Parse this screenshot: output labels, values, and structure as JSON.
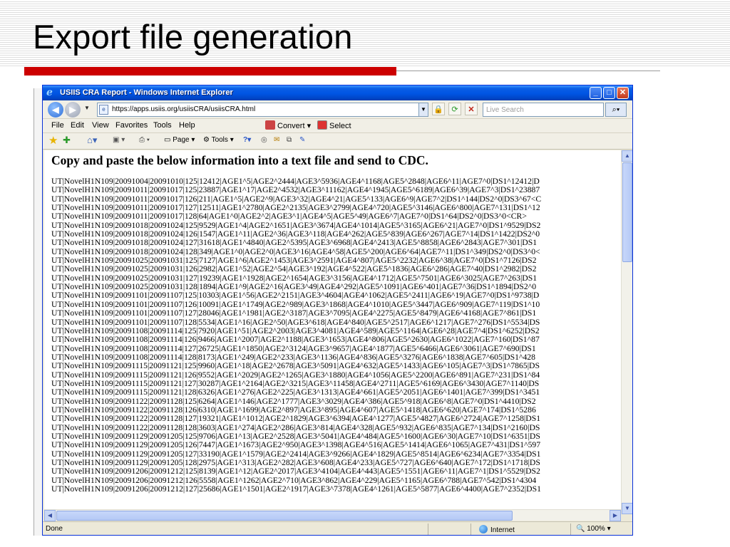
{
  "slide": {
    "title": "Export file generation"
  },
  "window": {
    "title": "USIIS CRA Report - Windows Internet Explorer",
    "controls": {
      "minimize": "_",
      "maximize": "□",
      "close": "✕"
    }
  },
  "address_bar": {
    "url": "https://apps.usiis.org/usiisCRA/usiisCRA.html",
    "search_placeholder": "Live Search"
  },
  "menu": {
    "items": [
      "File",
      "Edit",
      "View",
      "Favorites",
      "Tools",
      "Help"
    ],
    "convert": "Convert",
    "select": "Select"
  },
  "command_bar": {
    "page": "Page",
    "tools": "Tools"
  },
  "content": {
    "heading": "Copy and paste the below information into a text file and send to CDC.",
    "records": [
      "UT|NovelH1N109|20091004|20091010|125|12412|AGE1^5|AGE2^2444|AGE3^5936|AGE4^1168|AGE5^2848|AGE6^11|AGE7^0|DS1^12412|D",
      "UT|NovelH1N109|20091011|20091017|125|23887|AGE1^17|AGE2^4532|AGE3^11162|AGE4^1945|AGE5^6189|AGE6^39|AGE7^3|DS1^23887",
      "UT|NovelH1N109|20091011|20091017|126|211|AGE1^5|AGE2^9|AGE3^32|AGE4^21|AGE5^133|AGE6^9|AGE7^2|DS1^144|DS2^0|DS3^67<C",
      "UT|NovelH1N109|20091011|20091017|127|12511|AGE1^2780|AGE2^2135|AGE3^2799|AGE4^720|AGE5^3146|AGE6^800|AGE7^131|DS1^12",
      "UT|NovelH1N109|20091011|20091017|128|64|AGE1^0|AGE2^2|AGE3^1|AGE4^5|AGE5^49|AGE6^7|AGE7^0|DS1^64|DS2^0|DS3^0<CR>",
      "UT|NovelH1N109|20091018|20091024|125|9529|AGE1^4|AGE2^1651|AGE3^3674|AGE4^1014|AGE5^3165|AGE6^21|AGE7^0|DS1^9529|DS2",
      "UT|NovelH1N109|20091018|20091024|126|1547|AGE1^11|AGE2^36|AGE3^118|AGE4^262|AGE5^839|AGE6^267|AGE7^14|DS1^1422|DS2^0",
      "UT|NovelH1N109|20091018|20091024|127|31618|AGE1^4840|AGE2^5395|AGE3^6968|AGE4^2413|AGE5^8858|AGE6^2843|AGE7^301|DS1",
      "UT|NovelH1N109|20091018|20091024|128|349|AGE1^0|AGE2^0|AGE3^16|AGE4^58|AGE5^200|AGE6^64|AGE7^11|DS1^349|DS2^0|DS3^0<",
      "UT|NovelH1N109|20091025|20091031|125|7127|AGE1^6|AGE2^1453|AGE3^2591|AGE4^807|AGE5^2232|AGE6^38|AGE7^0|DS1^7126|DS2",
      "UT|NovelH1N109|20091025|20091031|126|2982|AGE1^52|AGE2^54|AGE3^192|AGE4^522|AGE5^1836|AGE6^286|AGE7^40|DS1^2982|DS2",
      "UT|NovelH1N109|20091025|20091031|127|19239|AGE1^1928|AGE2^1654|AGE3^3156|AGE4^1712|AGE5^7501|AGE6^3025|AGE7^263|DS1",
      "UT|NovelH1N109|20091025|20091031|128|1894|AGE1^9|AGE2^16|AGE3^49|AGE4^292|AGE5^1091|AGE6^401|AGE7^36|DS1^1894|DS2^0",
      "UT|NovelH1N109|20091101|20091107|125|10303|AGE1^56|AGE2^2151|AGE3^4604|AGE4^1062|AGE5^2411|AGE6^19|AGE7^0|DS1^9738|D",
      "UT|NovelH1N109|20091101|20091107|126|10091|AGE1^1749|AGE2^989|AGE3^1868|AGE4^1010|AGE5^3447|AGE6^909|AGE7^119|DS1^10",
      "UT|NovelH1N109|20091101|20091107|127|28046|AGE1^1981|AGE2^3187|AGE3^7095|AGE4^2275|AGE5^8479|AGE6^4168|AGE7^861|DS1",
      "UT|NovelH1N109|20091101|20091107|128|5534|AGE1^16|AGE2^50|AGE3^618|AGE4^840|AGE5^2517|AGE6^1217|AGE7^276|DS1^5534|DS",
      "UT|NovelH1N109|20091108|20091114|125|7920|AGE1^51|AGE2^2003|AGE3^4081|AGE4^589|AGE5^1164|AGE6^28|AGE7^4|DS1^6252|DS2",
      "UT|NovelH1N109|20091108|20091114|126|9466|AGE1^2007|AGE2^1188|AGE3^1653|AGE4^806|AGE5^2630|AGE6^1022|AGE7^160|DS1^87",
      "UT|NovelH1N109|20091108|20091114|127|26725|AGE1^1850|AGE2^3124|AGE3^9657|AGE4^1877|AGE5^6466|AGE6^3061|AGE7^690|DS1",
      "UT|NovelH1N109|20091108|20091114|128|8173|AGE1^249|AGE2^233|AGE3^1136|AGE4^836|AGE5^3276|AGE6^1838|AGE7^605|DS1^428",
      "UT|NovelH1N109|20091115|20091121|125|9960|AGE1^18|AGE2^2678|AGE3^5091|AGE4^632|AGE5^1433|AGE6^105|AGE7^3|DS1^7865|DS",
      "UT|NovelH1N109|20091115|20091121|126|9552|AGE1^2029|AGE2^1265|AGE3^1880|AGE4^1056|AGE5^2200|AGE6^891|AGE7^231|DS1^84",
      "UT|NovelH1N109|20091115|20091121|127|30287|AGE1^2164|AGE2^3215|AGE3^11458|AGE4^2711|AGE5^6169|AGE6^3430|AGE7^1140|DS",
      "UT|NovelH1N109|20091115|20091121|128|6326|AGE1^276|AGE2^225|AGE3^1313|AGE4^661|AGE5^2051|AGE6^1401|AGE7^399|DS1^3451",
      "UT|NovelH1N109|20091122|20091128|125|6264|AGE1^146|AGE2^1777|AGE3^3029|AGE4^386|AGE5^918|AGE6^8|AGE7^0|DS1^4410|DS2",
      "UT|NovelH1N109|20091122|20091128|126|6310|AGE1^1699|AGE2^897|AGE3^895|AGE4^607|AGE5^1418|AGE6^620|AGE7^174|DS1^5286",
      "UT|NovelH1N109|20091122|20091128|127|19321|AGE1^1012|AGE2^1829|AGE3^6394|AGE4^1277|AGE5^4827|AGE6^2724|AGE7^1258|DS1",
      "UT|NovelH1N109|20091122|20091128|128|3603|AGE1^274|AGE2^286|AGE3^814|AGE4^328|AGE5^932|AGE6^835|AGE7^134|DS1^2160|DS",
      "UT|NovelH1N109|20091129|20091205|125|9706|AGE1^13|AGE2^2528|AGE3^5041|AGE4^484|AGE5^1600|AGE6^30|AGE7^10|DS1^6351|DS",
      "UT|NovelH1N109|20091129|20091205|126|7447|AGE1^1673|AGE2^950|AGE3^1398|AGE4^516|AGE5^1414|AGE6^1065|AGE7^431|DS1^597",
      "UT|NovelH1N109|20091129|20091205|127|33190|AGE1^1579|AGE2^2414|AGE3^9266|AGE4^1829|AGE5^8514|AGE6^6234|AGE7^3354|DS1",
      "UT|NovelH1N109|20091129|20091205|128|2975|AGE1^313|AGE2^282|AGE3^608|AGE4^233|AGE5^727|AGE6^640|AGE7^172|DS1^1718|DS",
      "UT|NovelH1N109|20091206|20091212|125|8139|AGE1^12|AGE2^2017|AGE3^4104|AGE4^443|AGE5^1551|AGE6^11|AGE7^1|DS1^5529|DS2",
      "UT|NovelH1N109|20091206|20091212|126|5558|AGE1^1262|AGE2^710|AGE3^862|AGE4^229|AGE5^1165|AGE6^788|AGE7^542|DS1^4304",
      "UT|NovelH1N109|20091206|20091212|127|25686|AGE1^1501|AGE2^1917|AGE3^7378|AGE4^1261|AGE5^5877|AGE6^4400|AGE7^2352|DS1"
    ]
  },
  "status_bar": {
    "status": "Done",
    "zone": "Internet",
    "zoom": "100%"
  },
  "colors": {
    "accent_red": "#cc0000",
    "titlebar_blue": "#0054e3"
  }
}
